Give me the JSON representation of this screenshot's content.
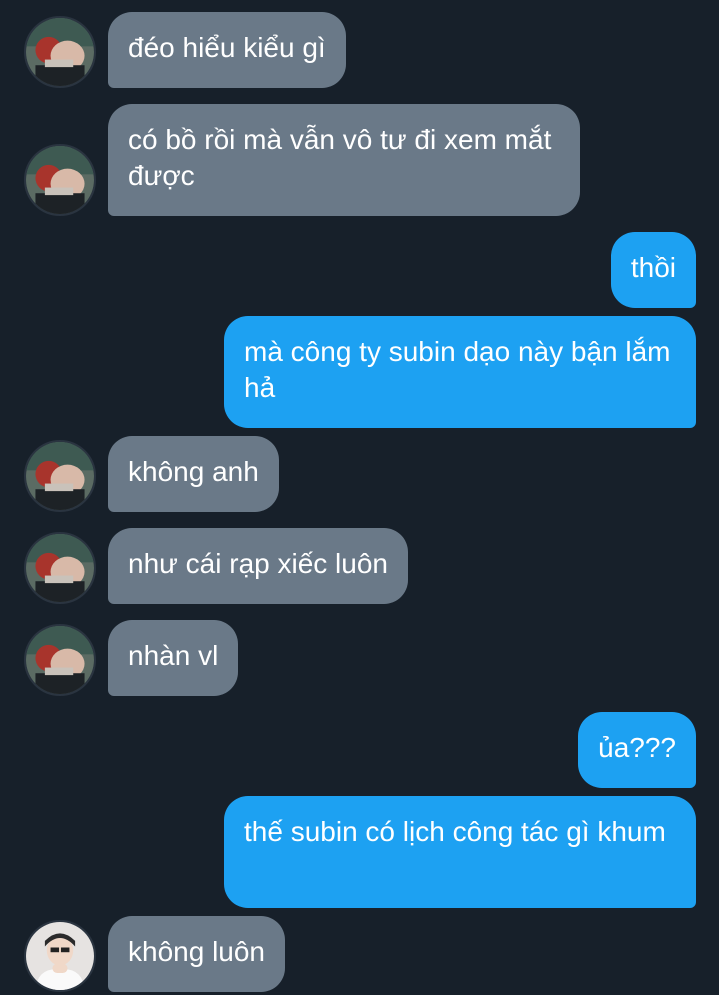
{
  "conversation": {
    "messages": [
      {
        "sender": "them",
        "text": "đéo hiểu kiểu gì"
      },
      {
        "sender": "them",
        "text": "có bồ rồi mà vẫn vô tư đi xem mắt được"
      },
      {
        "sender": "me",
        "text": "thồi"
      },
      {
        "sender": "me",
        "text": "mà công ty subin dạo này bận lắm hả"
      },
      {
        "sender": "them",
        "text": "không anh"
      },
      {
        "sender": "them",
        "text": "như cái rạp xiếc luôn"
      },
      {
        "sender": "them",
        "text": "nhàn vl"
      },
      {
        "sender": "me",
        "text": "ủa???"
      },
      {
        "sender": "me",
        "text": "thế subin có lịch công tác gì khum"
      },
      {
        "sender": "other",
        "text": "không luôn"
      }
    ]
  },
  "colors": {
    "background": "#17202a",
    "incoming_bubble": "#6a7988",
    "outgoing_bubble": "#1da1f2",
    "text": "#ffffff"
  },
  "icons": {
    "avatar_them": "anime-character-avatar-icon",
    "avatar_other": "person-photo-avatar-icon"
  }
}
